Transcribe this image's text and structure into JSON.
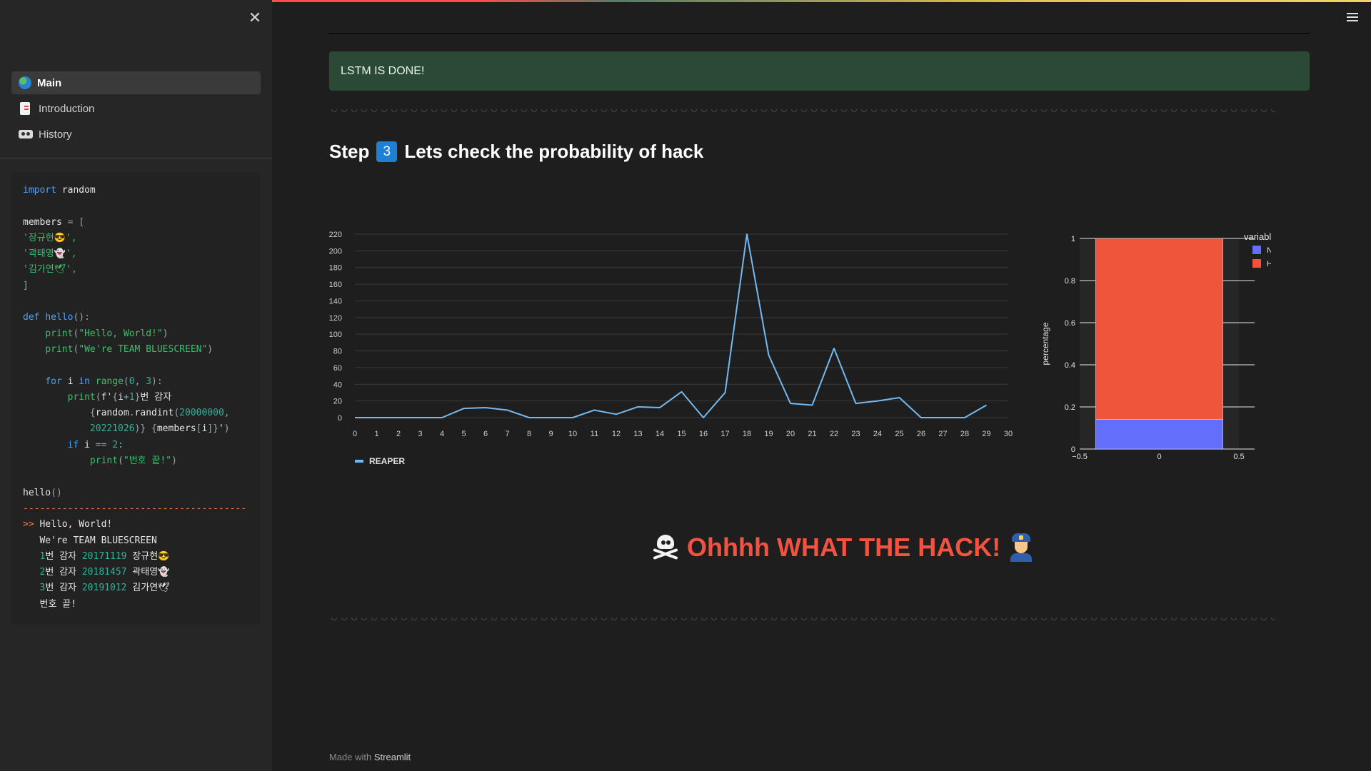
{
  "sidebar": {
    "close_label": "✕",
    "items": [
      {
        "label": "Main",
        "icon": "globe-icon",
        "active": true
      },
      {
        "label": "Introduction",
        "icon": "document-icon",
        "active": false
      },
      {
        "label": "History",
        "icon": "videotape-icon",
        "active": false
      }
    ]
  },
  "alert": {
    "text": "LSTM IS DONE!",
    "color": "#2b4a35"
  },
  "step": {
    "prefix": "Step",
    "number": "3",
    "title": "Lets check the probability of hack"
  },
  "chart_data": [
    {
      "type": "line",
      "x": [
        0,
        1,
        2,
        3,
        4,
        5,
        6,
        7,
        8,
        9,
        10,
        11,
        12,
        13,
        14,
        15,
        16,
        17,
        18,
        19,
        20,
        21,
        22,
        23,
        24,
        25,
        26,
        27,
        28,
        29
      ],
      "series": [
        {
          "name": "REAPER",
          "color": "#74b9ef",
          "values": [
            0,
            0,
            0,
            0,
            0,
            11,
            12,
            9,
            0,
            0,
            0,
            9,
            4,
            13,
            12,
            31,
            0,
            30,
            220,
            75,
            17,
            15,
            83,
            17,
            20,
            24,
            0,
            0,
            0,
            15
          ]
        }
      ],
      "xlim": [
        0,
        30
      ],
      "ylim": [
        0,
        220
      ],
      "yticks": [
        0,
        20,
        40,
        60,
        80,
        100,
        120,
        140,
        160,
        180,
        200,
        220
      ],
      "xticks": [
        0,
        1,
        2,
        3,
        4,
        5,
        6,
        7,
        8,
        9,
        10,
        11,
        12,
        13,
        14,
        15,
        16,
        17,
        18,
        19,
        20,
        21,
        22,
        23,
        24,
        25,
        26,
        27,
        28,
        29,
        30
      ],
      "grid": true,
      "legend": "bottom-left"
    },
    {
      "type": "bar",
      "stacked": true,
      "categories": [
        0
      ],
      "series": [
        {
          "name": "Normal",
          "color": "#636efa",
          "values": [
            0.14
          ]
        },
        {
          "name": "Hack",
          "color": "#ef553b",
          "values": [
            0.86
          ]
        }
      ],
      "xlim": [
        -0.5,
        0.5
      ],
      "ylim": [
        0,
        1
      ],
      "yticks": [
        0,
        0.2,
        0.4,
        0.6,
        0.8,
        1
      ],
      "yticklabels": [
        "0",
        "0.2",
        "0.4",
        "0.6",
        "0.8",
        "1"
      ],
      "xticks": [
        -0.5,
        0,
        0.5
      ],
      "xticklabels": [
        "−0.5",
        "0",
        "0.5"
      ],
      "ylabel": "percentage",
      "legend_title": "variable",
      "legend": "top-right"
    }
  ],
  "banner": {
    "text": "Ohhhh WHAT THE HACK!",
    "color": "#f25340"
  },
  "footer": {
    "prefix": "Made with",
    "brand": "Streamlit"
  }
}
